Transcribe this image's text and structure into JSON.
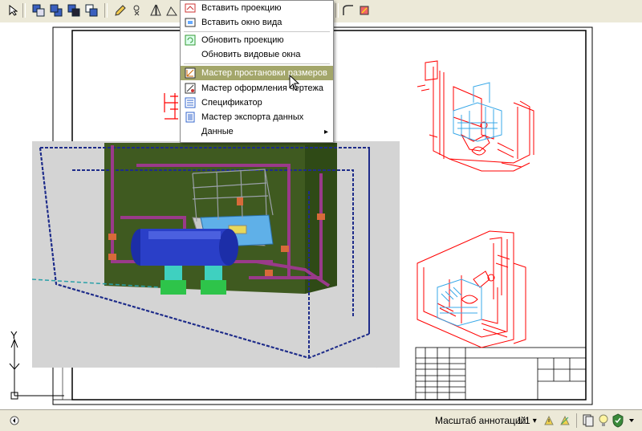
{
  "menu": {
    "items": [
      {
        "label": "Вставить проекцию",
        "icon": "insert-projection-icon"
      },
      {
        "label": "Вставить окно вида",
        "icon": "insert-viewport-icon"
      },
      {
        "label": "Обновить проекцию",
        "icon": "refresh-projection-icon"
      },
      {
        "label": "Обновить видовые окна",
        "icon": ""
      },
      {
        "label": "Мастер простановки размеров",
        "icon": "dimension-wizard-icon",
        "highlighted": true
      },
      {
        "label": "Мастер оформления чертежа",
        "icon": "drawing-layout-wizard-icon"
      },
      {
        "label": "Спецификатор",
        "icon": "specification-icon"
      },
      {
        "label": "Мастер экспорта данных",
        "icon": "data-export-icon"
      },
      {
        "label": "Данные",
        "icon": "",
        "submenu_arrow": "▸"
      }
    ]
  },
  "status": {
    "annotation_label": "Масштаб аннотаций:",
    "annotation_value": "1:1",
    "dropdown_arrow": "▾"
  },
  "axes": {
    "y": "Y"
  },
  "colors": {
    "menu_highlight": "#a3a66a",
    "wireframe_red": "#ff0000",
    "toolbar_bg": "#ece9d8"
  }
}
